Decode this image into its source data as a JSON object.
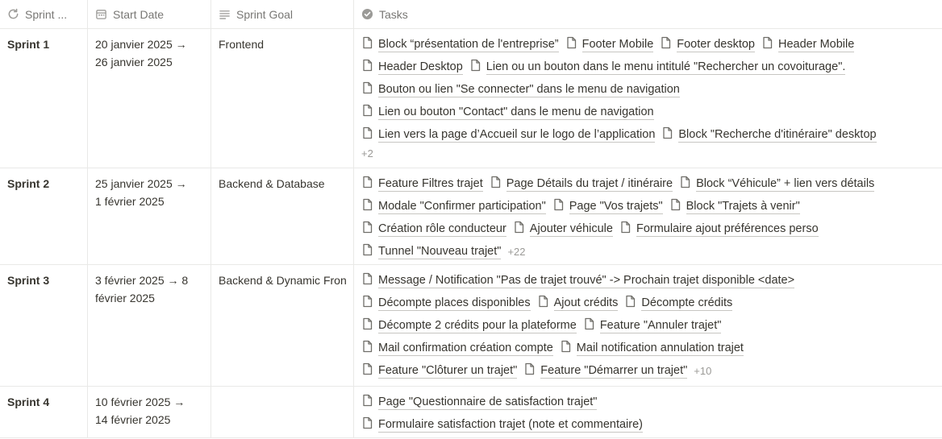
{
  "headers": {
    "sprint": "Sprint ...",
    "start_date": "Start Date",
    "sprint_goal": "Sprint Goal",
    "tasks": "Tasks"
  },
  "rows": [
    {
      "name": "Sprint 1",
      "date_start": "20 janvier 2025 →",
      "date_end": "26 janvier 2025",
      "goal": "Frontend",
      "task_lines": [
        [
          "Block “présentation de l'entreprise”",
          "Footer Mobile",
          "Footer desktop",
          "Header Mobile"
        ],
        [
          "Header Desktop",
          "Lien ou un bouton dans le menu intitulé \"Rechercher un covoiturage\"."
        ],
        [
          "Bouton ou lien \"Se connecter\" dans le menu de navigation"
        ],
        [
          "Lien ou bouton \"Contact\" dans le menu de navigation"
        ],
        [
          "Lien vers la page d’Accueil sur le logo de l’application",
          "Block \"Recherche d'itinéraire\" desktop"
        ]
      ],
      "more": "+2"
    },
    {
      "name": "Sprint 2",
      "date_start": "25 janvier 2025 →",
      "date_end": "1 février 2025",
      "goal": "Backend & Database",
      "task_lines": [
        [
          "Feature Filtres trajet",
          "Page Détails du trajet / itinéraire",
          "Block “Véhicule” + lien vers détails"
        ],
        [
          "Modale \"Confirmer participation\"",
          "Page \"Vos trajets\"",
          "Block \"Trajets à venir\""
        ],
        [
          "Création rôle conducteur",
          "Ajouter véhicule",
          "Formulaire ajout préférences perso"
        ],
        [
          "Tunnel \"Nouveau trajet\""
        ]
      ],
      "more": "+22"
    },
    {
      "name": "Sprint 3",
      "date_start": "3 février 2025 → 8",
      "date_end": "février 2025",
      "goal": "Backend & Dynamic Fron",
      "task_lines": [
        [
          "Message / Notification \"Pas de trajet trouvé\" -> Prochain trajet disponible <date>"
        ],
        [
          "Décompte places disponibles",
          "Ajout crédits",
          "Décompte crédits"
        ],
        [
          "Décompte 2 crédits pour la plateforme",
          "Feature \"Annuler trajet\""
        ],
        [
          "Mail confirmation création compte",
          "Mail notification annulation trajet"
        ],
        [
          "Feature \"Clôturer un trajet\"",
          "Feature \"Démarrer un trajet\""
        ]
      ],
      "more": "+10"
    },
    {
      "name": "Sprint 4",
      "date_start": "10 février 2025 →",
      "date_end": "14 février 2025",
      "goal": "",
      "task_lines": [
        [
          "Page \"Questionnaire de satisfaction trajet\""
        ],
        [
          "Formulaire satisfaction trajet (note et commentaire)"
        ]
      ],
      "more": ""
    }
  ],
  "icons": {
    "sprint_header": "rotate-arrow-icon",
    "date_header": "calendar-icon",
    "goal_header": "text-lines-icon",
    "tasks_header": "check-circle-icon",
    "task_item": "page-icon"
  }
}
